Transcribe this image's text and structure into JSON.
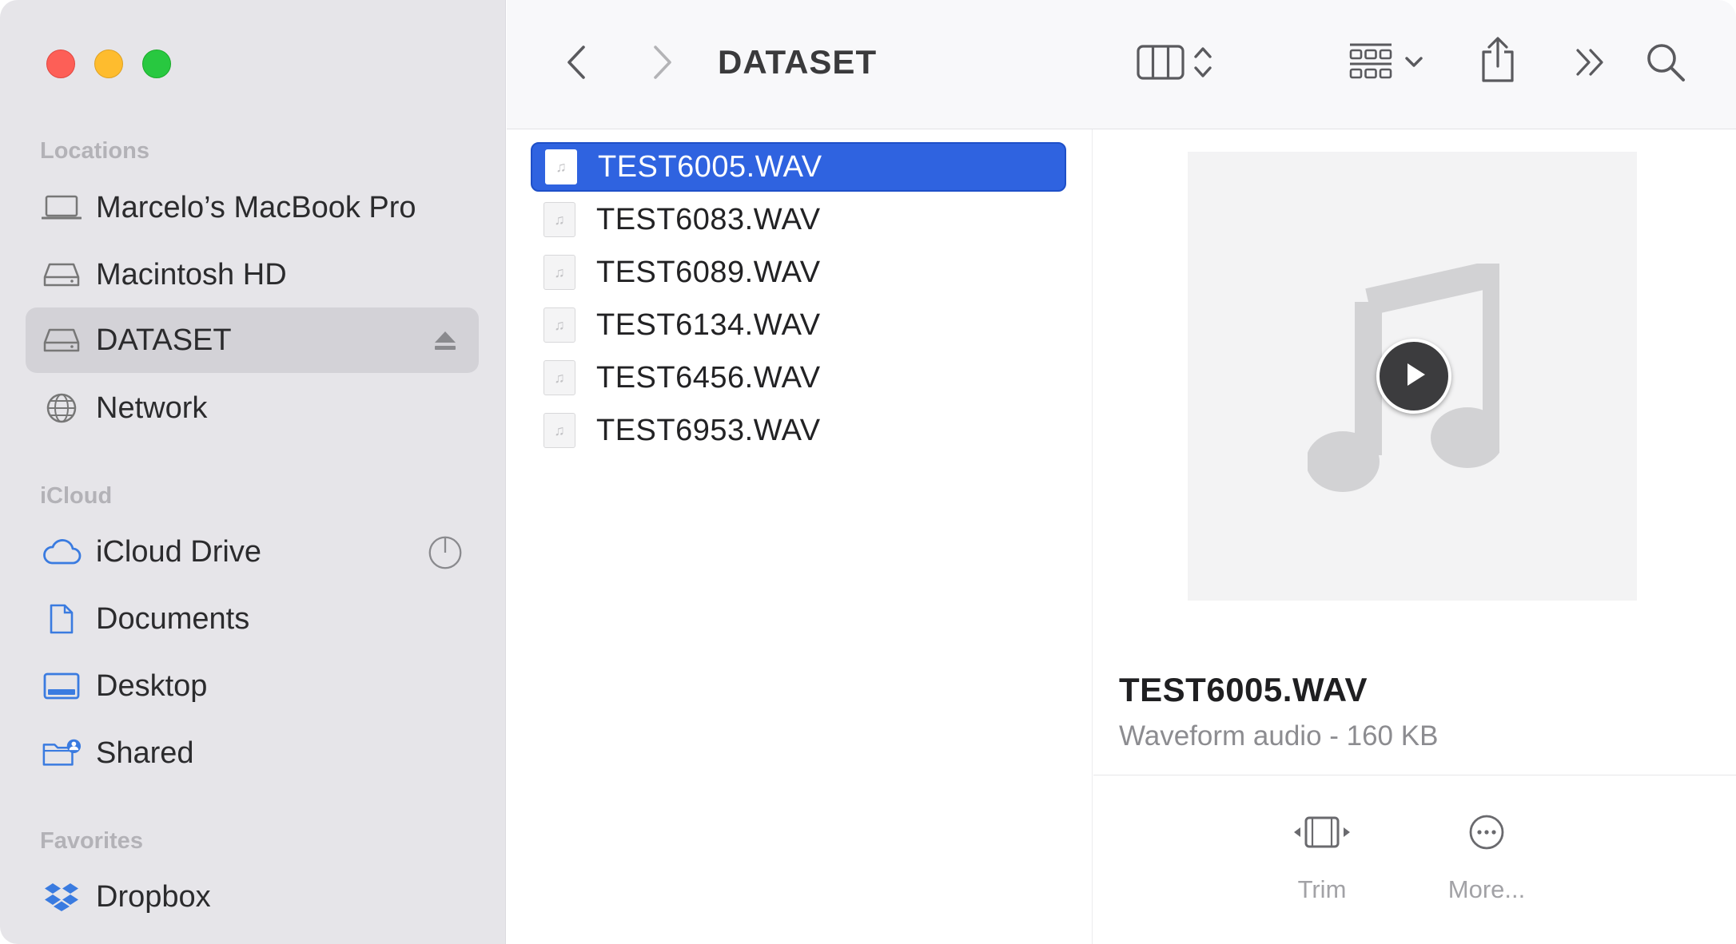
{
  "window": {
    "title": "DATASET"
  },
  "sidebar": {
    "sections": [
      {
        "title": "Locations",
        "items": [
          {
            "label": "Marcelo’s MacBook Pro",
            "icon": "laptop-icon"
          },
          {
            "label": "Macintosh HD",
            "icon": "disk-icon"
          },
          {
            "label": "DATASET",
            "icon": "external-disk-icon",
            "active": true,
            "action_icon": "eject-icon"
          },
          {
            "label": "Network",
            "icon": "globe-icon"
          }
        ]
      },
      {
        "title": "iCloud",
        "items": [
          {
            "label": "iCloud Drive",
            "icon": "cloud-icon",
            "action_icon": "sync-progress-icon"
          },
          {
            "label": "Documents",
            "icon": "document-icon"
          },
          {
            "label": "Desktop",
            "icon": "desktop-icon"
          },
          {
            "label": "Shared",
            "icon": "shared-folder-icon"
          }
        ]
      },
      {
        "title": "Favorites",
        "items": [
          {
            "label": "Dropbox",
            "icon": "dropbox-icon"
          }
        ]
      }
    ]
  },
  "toolbar": {
    "back_icon": "chevron-left-icon",
    "forward_icon": "chevron-right-icon",
    "view_icon": "column-view-icon",
    "view_toggle_icon": "up-down-chevron-icon",
    "group_icon": "grid-group-icon",
    "group_dropdown_icon": "chevron-down-icon",
    "share_icon": "share-icon",
    "more_icon": "double-chevron-right-icon",
    "search_icon": "search-icon"
  },
  "files": [
    {
      "name": "TEST6005.WAV",
      "selected": true
    },
    {
      "name": "TEST6083.WAV"
    },
    {
      "name": "TEST6089.WAV"
    },
    {
      "name": "TEST6134.WAV"
    },
    {
      "name": "TEST6456.WAV"
    },
    {
      "name": "TEST6953.WAV"
    }
  ],
  "preview": {
    "name": "TEST6005.WAV",
    "kind": "Waveform audio - 160 KB",
    "thumbnail_icon": "music-note-icon",
    "play_icon": "play-icon",
    "actions": [
      {
        "label": "Trim",
        "icon": "trim-icon"
      },
      {
        "label": "More...",
        "icon": "more-icon"
      }
    ]
  },
  "colors": {
    "selection": "#2f63e0",
    "sidebar_bg": "#e6e5e9",
    "accent_icon": "#3a7be0"
  }
}
